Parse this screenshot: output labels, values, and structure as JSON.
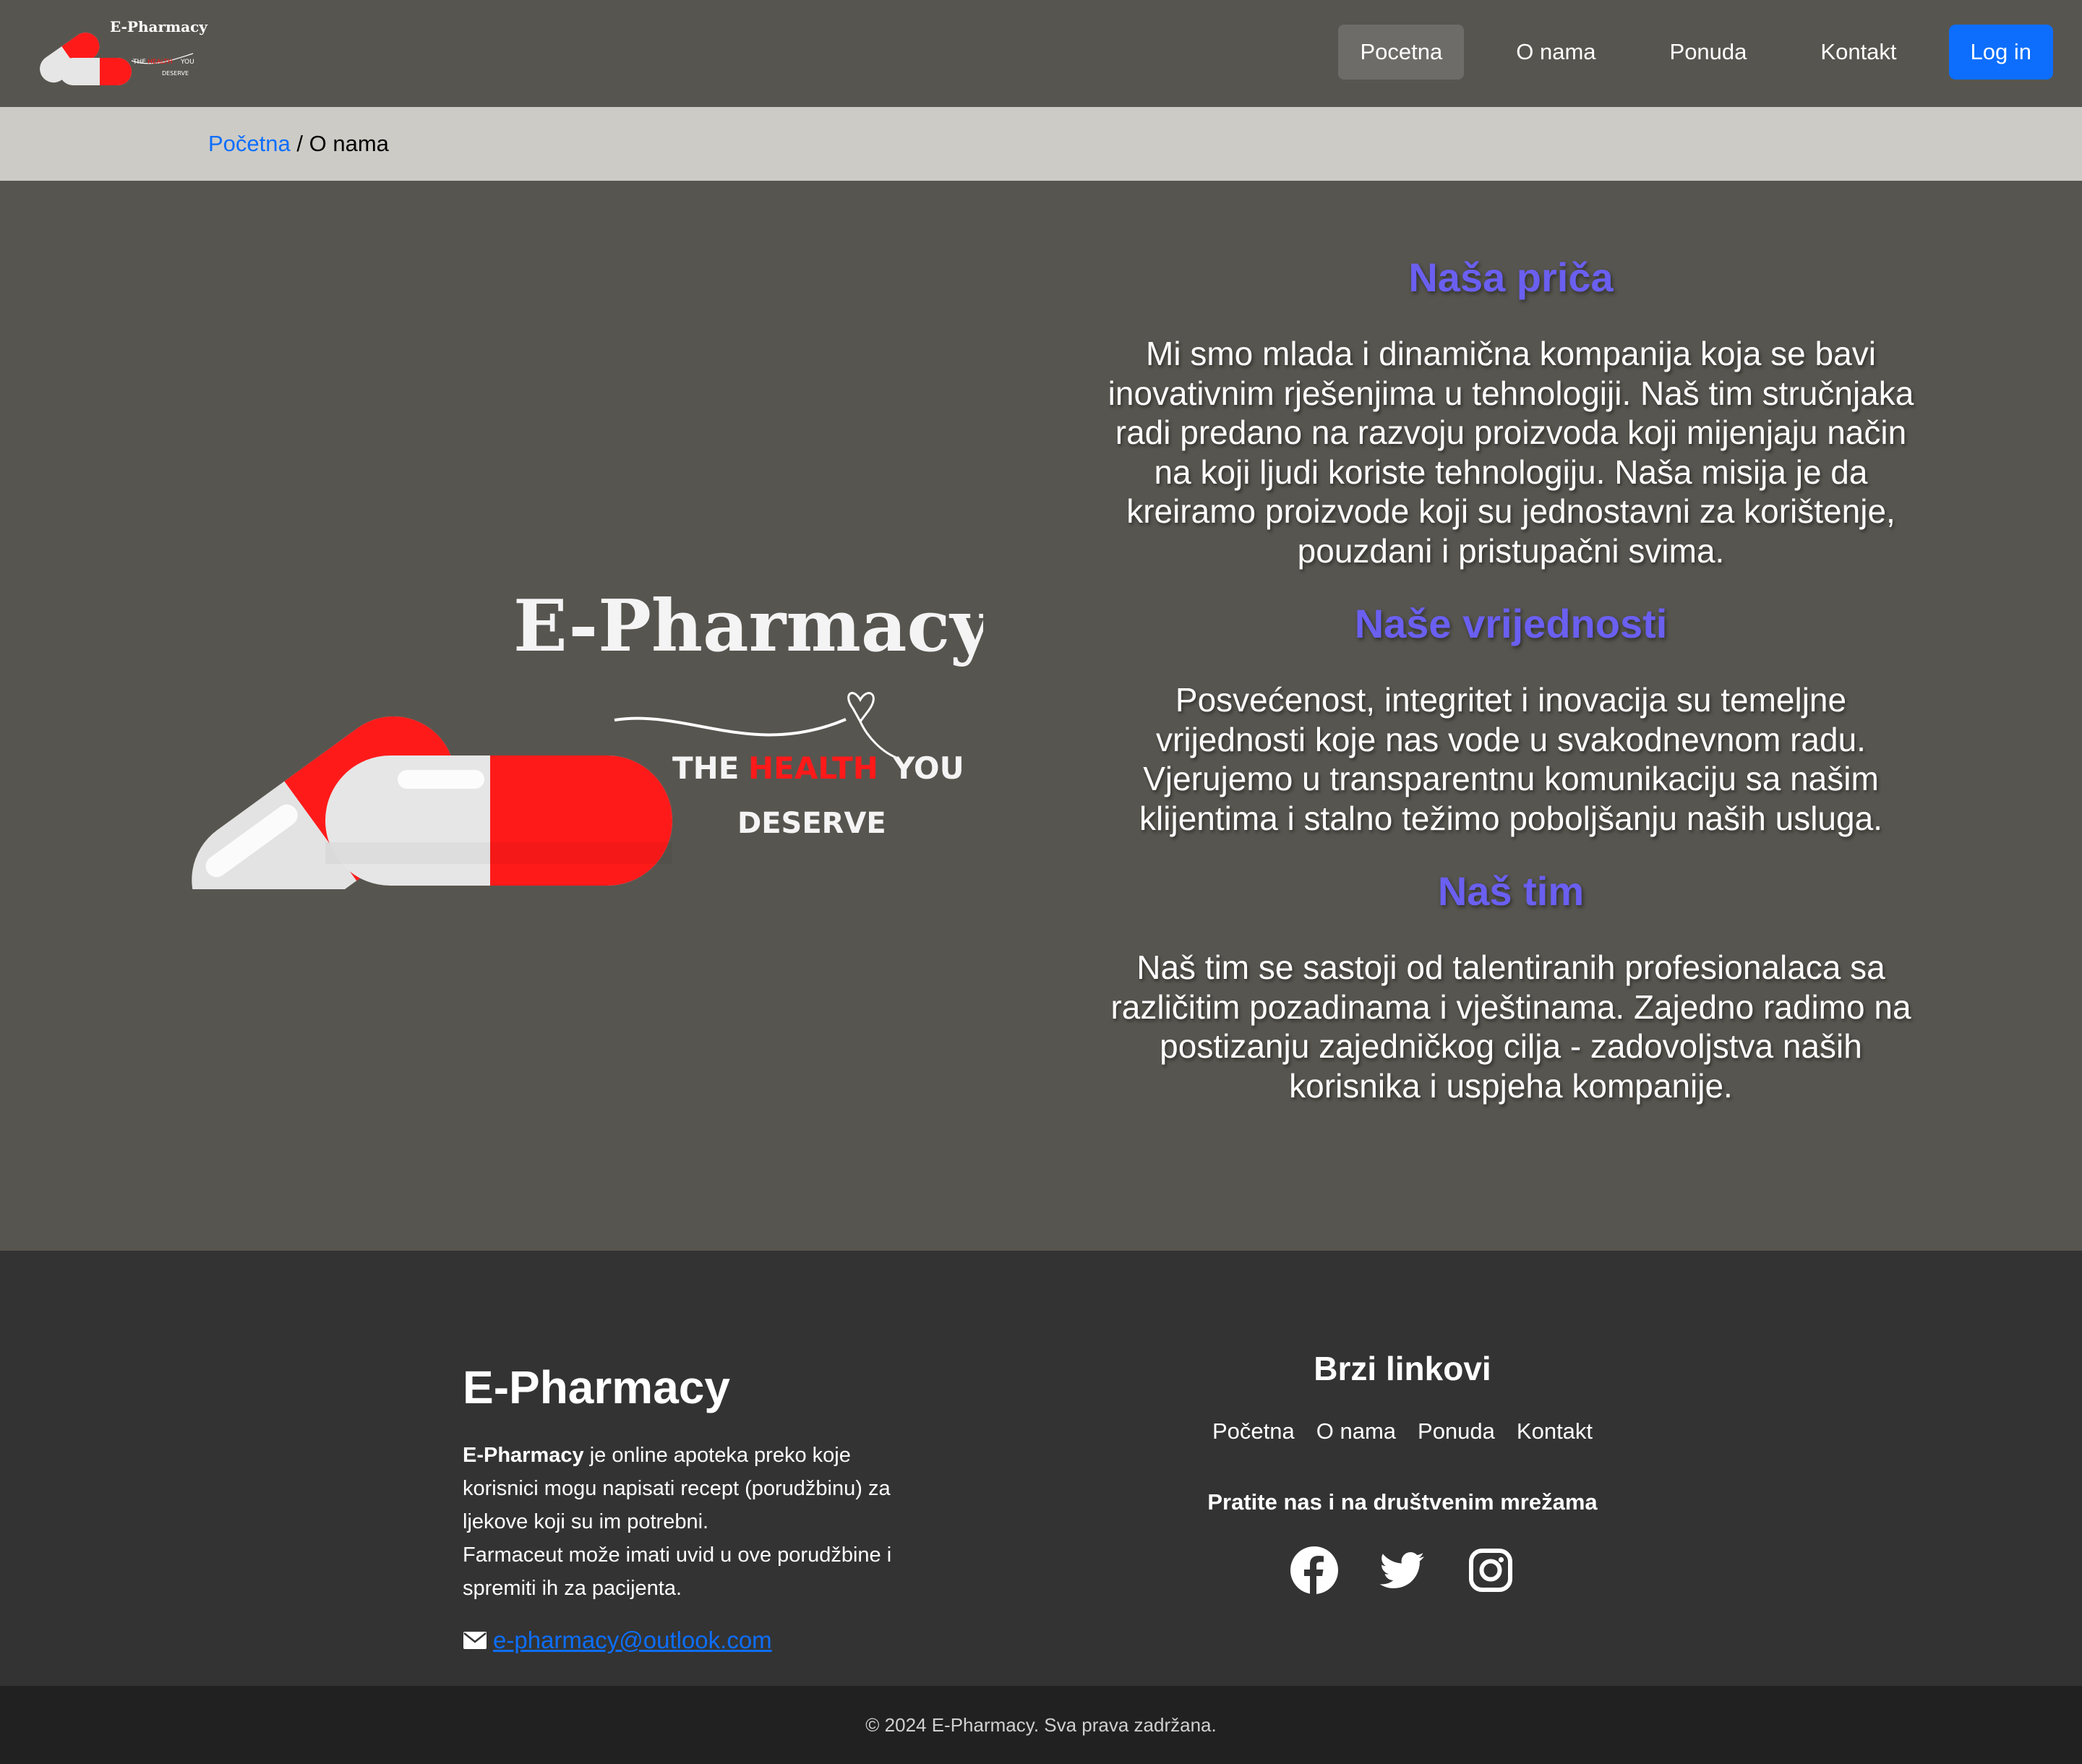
{
  "brand": {
    "name": "E-Pharmacy",
    "tagline_the": "THE",
    "tagline_health": "HEALTH",
    "tagline_you": "YOU",
    "tagline_deserve": "DESERVE",
    "pill_red": "#ff1a1a",
    "pill_white": "#e6e6e6"
  },
  "nav": {
    "items": [
      {
        "label": "Pocetna"
      },
      {
        "label": "O nama"
      },
      {
        "label": "Ponuda"
      },
      {
        "label": "Kontakt"
      }
    ],
    "login_label": "Log in"
  },
  "breadcrumb": {
    "home": "Početna",
    "separator": " / ",
    "current": "O nama"
  },
  "about": {
    "story_title": "Naša priča",
    "story_text": "Mi smo mlada i dinamična kompanija koja se bavi inovativnim rješenjima u tehnologiji. Naš tim stručnjaka radi predano na razvoju proizvoda koji mijenjaju način na koji ljudi koriste tehnologiju. Naša misija je da kreiramo proizvode koji su jednostavni za korištenje, pouzdani i pristupačni svima.",
    "values_title": "Naše vrijednosti",
    "values_text": "Posvećenost, integritet i inovacija su temeljne vrijednosti koje nas vode u svakodnevnom radu. Vjerujemo u transparentnu komunikaciju sa našim klijentima i stalno težimo poboljšanju naših usluga.",
    "team_title": "Naš tim",
    "team_text": "Naš tim se sastoji od talentiranih profesionalaca sa različitim pozadinama i vještinama. Zajedno radimo na postizanju zajedničkog cilja - zadovoljstva naših korisnika i uspjeha kompanije."
  },
  "footer": {
    "title": "E-Pharmacy",
    "desc_bold": "E-Pharmacy",
    "desc_rest": " je online apoteka preko koje korisnici mogu napisati recept (porudžbinu) za ljekove koji su im potrebni.",
    "desc_line2": "Farmaceut može imati uvid u ove porudžbine i spremiti ih za pacijenta.",
    "email": "e-pharmacy@outlook.com",
    "quick_title": "Brzi linkovi",
    "quick_links": [
      {
        "label": "Početna"
      },
      {
        "label": "O nama"
      },
      {
        "label": "Ponuda"
      },
      {
        "label": "Kontakt"
      }
    ],
    "social_title": "Pratite nas i na društvenim mrežama",
    "socials": [
      "facebook-icon",
      "twitter-icon",
      "instagram-icon"
    ],
    "copyright": "© 2024 E-Pharmacy. Sva prava zadržana."
  },
  "colors": {
    "background": "#57554f",
    "breadcrumb_bg": "#cdcbc5",
    "accent_blue": "#0d6efd",
    "heading_purple": "#6a5ff0",
    "footer_bg": "#333333",
    "copyright_bg": "#212121"
  }
}
